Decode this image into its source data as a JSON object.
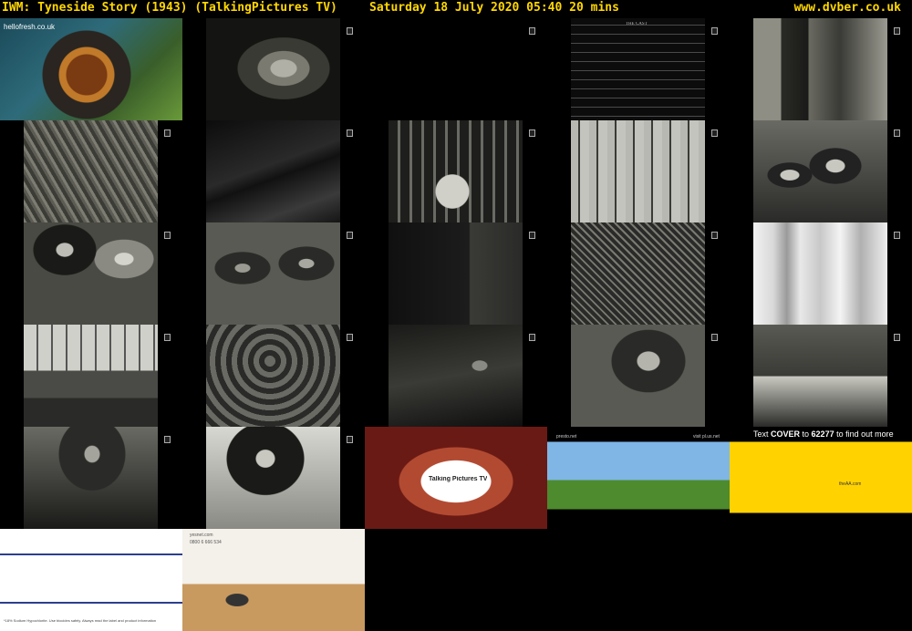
{
  "header": {
    "title": "IWM: Tyneside Story (1943) (TalkingPictures TV)",
    "date_time": "Saturday 18 July 2020  05:40  20 mins",
    "site": "www.dvber.co.uk"
  },
  "ads": {
    "hellofresh_logo": "hellofresh.co.uk",
    "talkingpictures_name": "Talking Pictures TV",
    "presto_brand": "presto.net",
    "presto_site": "visit pl.us.net",
    "aa_prefix": "Text ",
    "aa_keyword": "COVER",
    "aa_middle": " to ",
    "aa_number": "62277",
    "aa_suffix": " to find out more",
    "aa_van_text": "theAA.com",
    "hygienic_disclaimer": "*18% Sodium Hypochlorite. Use biocides safely. Always read the label and product information",
    "yesnet_site": "yesnet.com",
    "yesnet_phone": "0800 6 666 534"
  },
  "credits": {
    "heading": "THE CAST"
  },
  "colors": {
    "header_text": "#ffd700",
    "aa_yellow": "#ffd200",
    "divider_blue": "#2c3e8c"
  }
}
